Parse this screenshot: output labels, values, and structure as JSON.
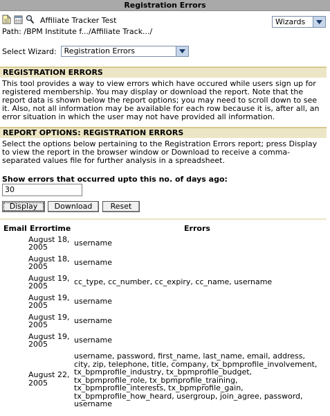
{
  "window": {
    "title": "Registration Errors"
  },
  "toolbar": {
    "icons": [
      "document-icon",
      "calendar-icon",
      "search-icon"
    ],
    "site_name": "Affiliate Tracker Test",
    "wizards_label": "Wizards"
  },
  "path": "Path: /BPM Institute f.../Affiliate Track.../",
  "wizard_select": {
    "label": "Select Wizard:",
    "value": "Registration Errors"
  },
  "section1": {
    "title": "REGISTRATION ERRORS",
    "text": "This tool provides a way to view errors which have occured while users sign up for registered membership. You may display or download the report. Note that the report data is shown below the report options; you may need to scroll down to see it. Also, not all information may be available for each row because it is, after all, an error situation in which the user may not have provided all information."
  },
  "section2": {
    "title": "REPORT OPTIONS: REGISTRATION ERRORS",
    "text": "Select the options below pertaining to the Registration Errors report; press Display to view the report in the browser window or Download to receive a comma-separated values file for further analysis in a spreadsheet."
  },
  "days_field": {
    "label": "Show errors that occurred upto this no. of days ago:",
    "value": "30"
  },
  "buttons": {
    "display": "Display",
    "download": "Download",
    "reset": "Reset"
  },
  "table": {
    "headers": {
      "email": "Email",
      "errortime": "Errortime",
      "errors": "Errors"
    },
    "rows": [
      {
        "email": "",
        "date": "August 18, 2005",
        "errors": "username"
      },
      {
        "email": "",
        "date": "August 18, 2005",
        "errors": "username"
      },
      {
        "email": "",
        "date": "August 19, 2005",
        "errors": "cc_type, cc_number, cc_expiry, cc_name, username"
      },
      {
        "email": "",
        "date": "August 19, 2005",
        "errors": "username"
      },
      {
        "email": "",
        "date": "August 19, 2005",
        "errors": "username"
      },
      {
        "email": "",
        "date": "August 19, 2005",
        "errors": "username"
      },
      {
        "email": "",
        "date": "August 22, 2005",
        "errors": "username, password, first_name, last_name, email, address, city, zip, telephone, title, company, tx_bpmprofile_involvement, tx_bpmprofile_industry, tx_bpmprofile_budget, tx_bpmprofile_role, tx_bpmprofile_training, tx_bpmprofile_interests, tx_bpmprofile_gain, tx_bpmprofile_how_heard, usergroup, join_agree, password, username"
      }
    ]
  }
}
